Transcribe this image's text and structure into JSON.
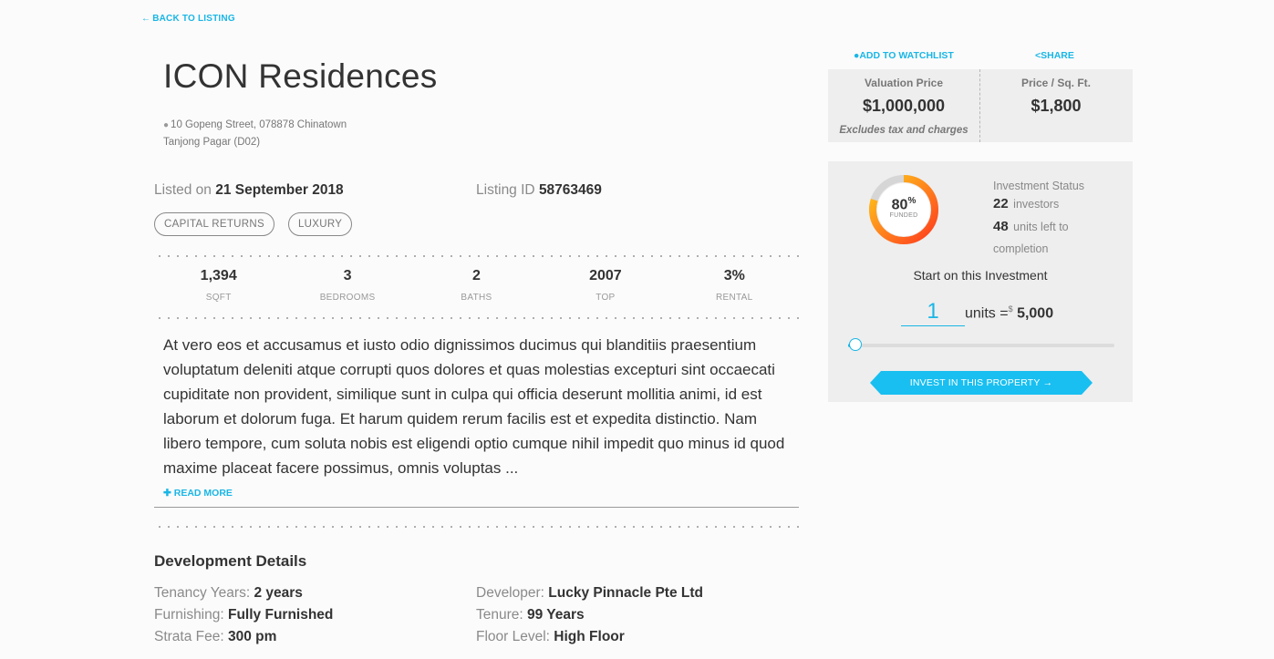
{
  "nav": {
    "back_label": "BACK TO LISTING",
    "back_icon": "arrow-left-icon"
  },
  "property": {
    "title": "ICON Residences",
    "address_line1": "10 Gopeng Street, 078878 Chinatown",
    "address_line2": "Tanjong Pagar (D02)",
    "listed_label": "Listed on",
    "listed_date": "21 September 2018",
    "listing_id_label": "Listing ID",
    "listing_id": "58763469",
    "tags": [
      "CAPITAL RETURNS",
      "LUXURY"
    ]
  },
  "stats": [
    {
      "value": "1,394",
      "label": "SQFT"
    },
    {
      "value": "3",
      "label": "BEDROOMS"
    },
    {
      "value": "2",
      "label": "BATHS"
    },
    {
      "value": "2007",
      "label": "TOP"
    },
    {
      "value": "3%",
      "label": "RENTAL"
    }
  ],
  "description": "At vero eos et accusamus et iusto odio dignissimos ducimus qui blanditiis praesentium voluptatum deleniti atque corrupti quos dolores et quas molestias excepturi sint occaecati cupiditate non provident, similique sunt in culpa qui officia deserunt mollitia animi, id est laborum et dolorum fuga. Et harum quidem rerum facilis est et expedita distinctio. Nam libero tempore, cum soluta nobis est eligendi optio cumque nihil impedit quo minus id quod maxime placeat facere possimus, omnis voluptas ...",
  "read_more": "READ MORE",
  "development": {
    "title": "Development Details",
    "left": [
      {
        "label": "Tenancy Years:",
        "value": "2 years"
      },
      {
        "label": "Furnishing:",
        "value": "Fully Furnished"
      },
      {
        "label": "Strata Fee:",
        "value": "300 pm"
      }
    ],
    "right": [
      {
        "label": "Developer:",
        "value": "Lucky Pinnacle Pte Ltd"
      },
      {
        "label": "Tenure:",
        "value": "99 Years"
      },
      {
        "label": "Floor Level:",
        "value": "High Floor"
      }
    ]
  },
  "actions": {
    "watchlist": "ADD TO WATCHLIST",
    "share": "SHARE"
  },
  "pricing": {
    "valuation_label": "Valuation Price",
    "valuation_value": "$1,000,000",
    "valuation_note": "Excludes tax and charges",
    "psf_label": "Price / Sq. Ft.",
    "psf_value": "$1,800"
  },
  "investment": {
    "funded_percent": 80,
    "funded_pct_label": "80",
    "pct_symbol": "%",
    "funded_label": "FUNDED",
    "status_label": "Investment Status",
    "investors_count": "22",
    "investors_label": "investors",
    "units_left": "48",
    "units_left_label": "units left to",
    "completion_label": "completion",
    "start_label": "Start on this Investment",
    "units_value": "1",
    "units_label": "units =",
    "currency_symbol": "$",
    "amount": "5,000",
    "slider_fraction": 0.02,
    "invest_button": "INVEST IN THIS PROPERTY"
  },
  "colors": {
    "accent": "#19b6e6",
    "ring_start": "#ff3b1f",
    "ring_end": "#ffcc1a"
  }
}
